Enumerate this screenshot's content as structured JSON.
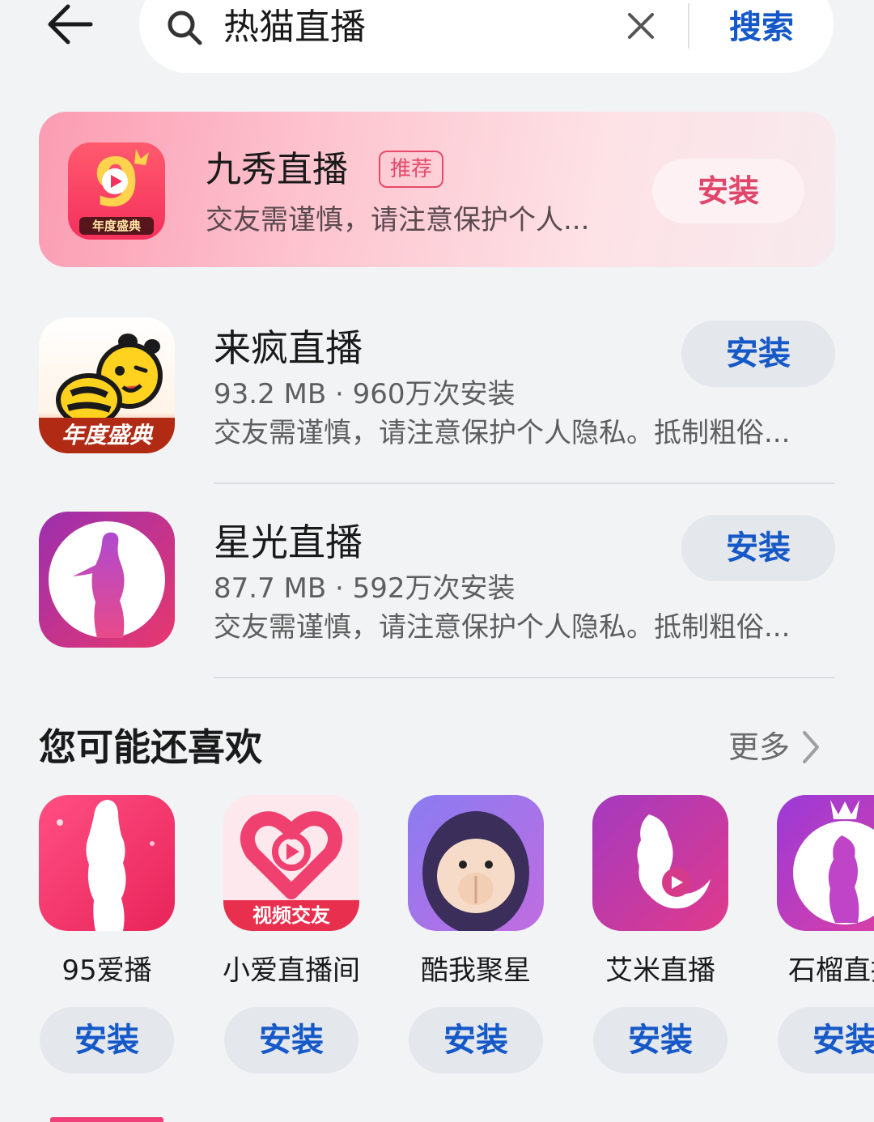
{
  "search": {
    "query": "热猫直播",
    "submit_label": "搜索"
  },
  "promo": {
    "title": "九秀直播",
    "tag": "推荐",
    "description": "交友需谨慎，请注意保护个人...",
    "install_label": "安装",
    "icon_badge": "年度盛典"
  },
  "results": [
    {
      "name": "来疯直播",
      "meta": "93.2 MB · 960万次安装",
      "description": "交友需谨慎，请注意保护个人隐私。抵制粗俗...",
      "install_label": "安装",
      "icon_badge": "年度盛典"
    },
    {
      "name": "星光直播",
      "meta": "87.7 MB · 592万次安装",
      "description": "交友需谨慎，请注意保护个人隐私。抵制粗俗...",
      "install_label": "安装"
    }
  ],
  "recommend": {
    "title": "您可能还喜欢",
    "more_label": "更多",
    "apps": [
      {
        "name": "95爱播",
        "install_label": "安装"
      },
      {
        "name": "小爱直播间",
        "install_label": "安装",
        "icon_badge": "视频交友"
      },
      {
        "name": "酷我聚星",
        "install_label": "安装"
      },
      {
        "name": "艾米直播",
        "install_label": "安装"
      },
      {
        "name": "石榴直播",
        "install_label": "安装"
      }
    ]
  },
  "colors": {
    "accent": "#1558c8",
    "promo_accent": "#e8496a",
    "background": "#f1f3f5"
  }
}
